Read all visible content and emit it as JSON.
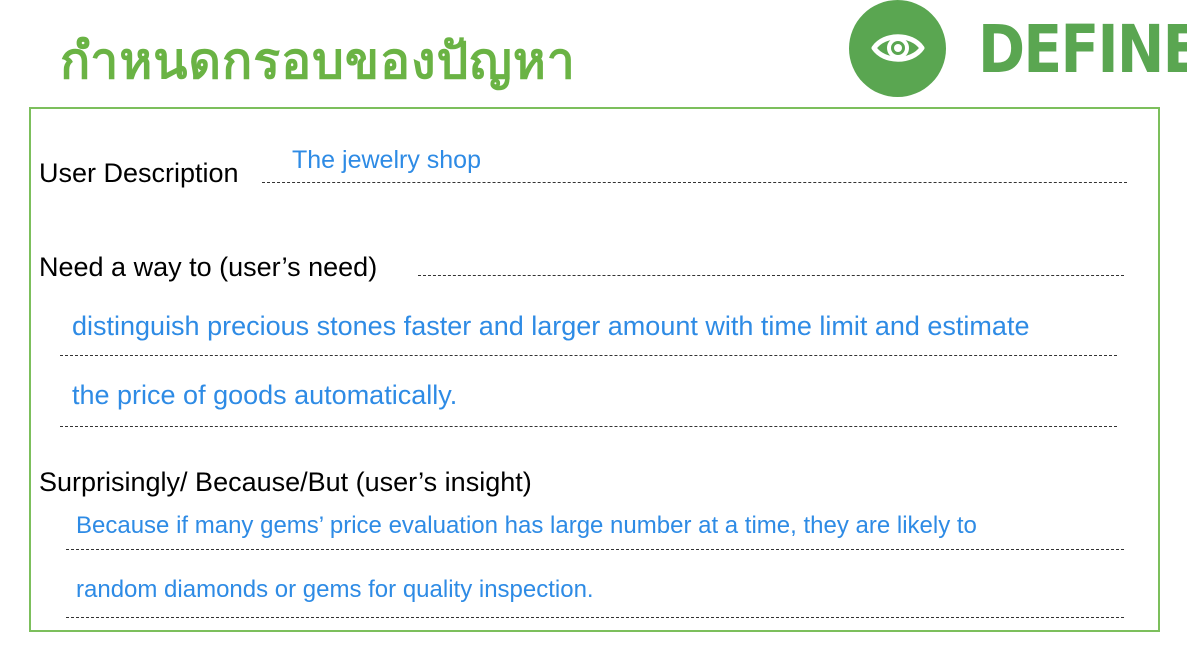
{
  "header": {
    "title_thai": "กำหนดกรอบของปัญหา",
    "stage_label": "DEFINE",
    "stage_icon": "eye-icon",
    "accent_color": "#5aa651"
  },
  "worksheet": {
    "user_description": {
      "label": "User Description",
      "answer": "The jewelry shop"
    },
    "need": {
      "label": "Need a way to (user’s need)",
      "answer_lines": [
        "distinguish precious stones faster and larger amount with time limit and estimate",
        "the price of goods automatically."
      ]
    },
    "insight": {
      "label": "Surprisingly/ Because/But (user’s insight)",
      "answer_lines": [
        "Because if many gems’ price evaluation has large number at a time, they are likely to",
        "random diamonds or gems for quality inspection."
      ]
    },
    "answer_color": "#2e8be5"
  }
}
